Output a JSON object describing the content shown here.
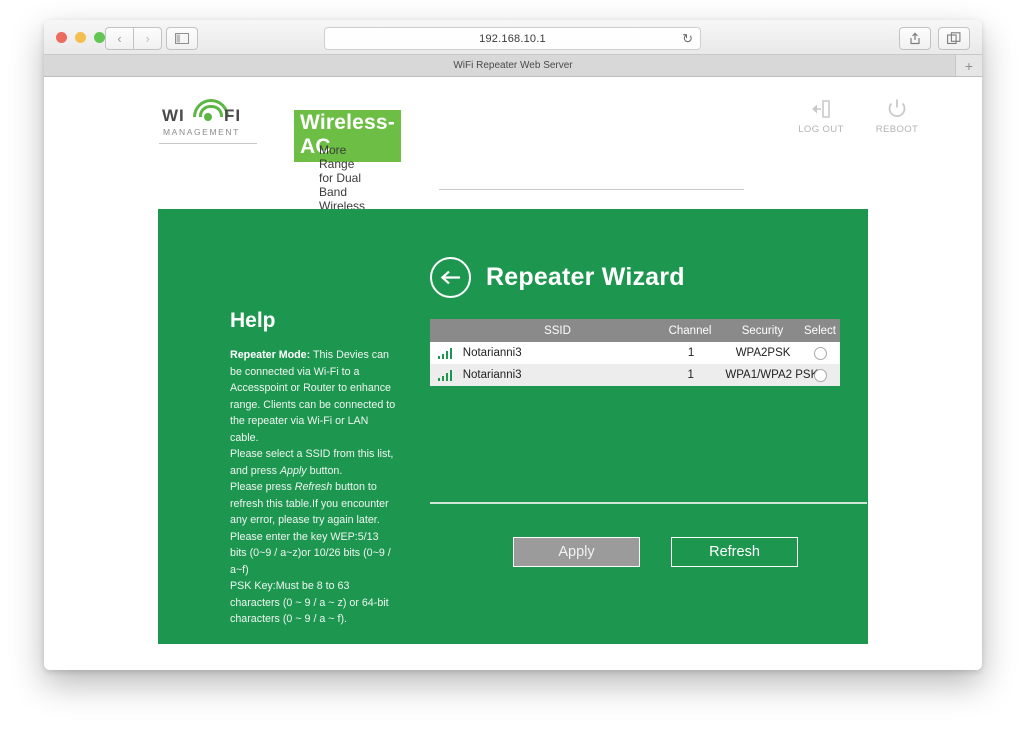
{
  "browser": {
    "url": "192.168.10.1",
    "tab_title": "WiFi Repeater Web Server",
    "new_tab_label": "+",
    "back_label": "‹",
    "forward_label": "›",
    "reload_label": "↻"
  },
  "header": {
    "logo": {
      "wi": "WI",
      "fi": "FI",
      "management": "MANAGEMENT"
    },
    "product_badge": "Wireless-AC",
    "tagline": "More Range for Dual Band Wireless Network",
    "actions": [
      {
        "label": "LOG OUT",
        "icon": "logout-icon"
      },
      {
        "label": "REBOOT",
        "icon": "power-icon"
      }
    ]
  },
  "help": {
    "title": "Help",
    "mode_label": "Repeater Mode:",
    "mode_text": " This Devies can be connected via Wi-Fi to a Accesspoint or Router to enhance range. Clients can be connected to the repeater via Wi-Fi or LAN cable.",
    "line_apply_a": "Please select a SSID from this list, and press ",
    "line_apply_em": "Apply",
    "line_apply_b": " button.",
    "line_refresh_a": "Please press ",
    "line_refresh_em": "Refresh",
    "line_refresh_b": " button to refresh this table.If you encounter any error, please try again later.",
    "line_wep": "Please enter the key WEP:5/13 bits (0~9 / a~z)or 10/26 bits (0~9 / a~f)",
    "line_psk": "PSK Key:Must be 8 to 63 characters (0 ~ 9 / a ~ z) or 64-bit characters (0 ~ 9 / a ~ f)."
  },
  "wizard": {
    "title": "Repeater Wizard",
    "back_icon": "back-arrow-icon"
  },
  "table": {
    "columns": [
      "SSID",
      "Channel",
      "Security",
      "Select"
    ],
    "rows": [
      {
        "signal": "signal-bars-icon",
        "ssid": "Notarianni3",
        "channel": "1",
        "security": "WPA2PSK",
        "selected": false
      },
      {
        "signal": "signal-bars-icon",
        "ssid": "Notarianni3",
        "channel": "1",
        "security": "WPA1/WPA2 PSK",
        "selected": false
      }
    ]
  },
  "buttons": {
    "apply": "Apply",
    "refresh": "Refresh"
  },
  "colors": {
    "panel_green": "#1d9750",
    "badge_green": "#6cbe45",
    "table_header_gray": "#8a8a8a",
    "apply_gray": "#9b9b9b"
  }
}
